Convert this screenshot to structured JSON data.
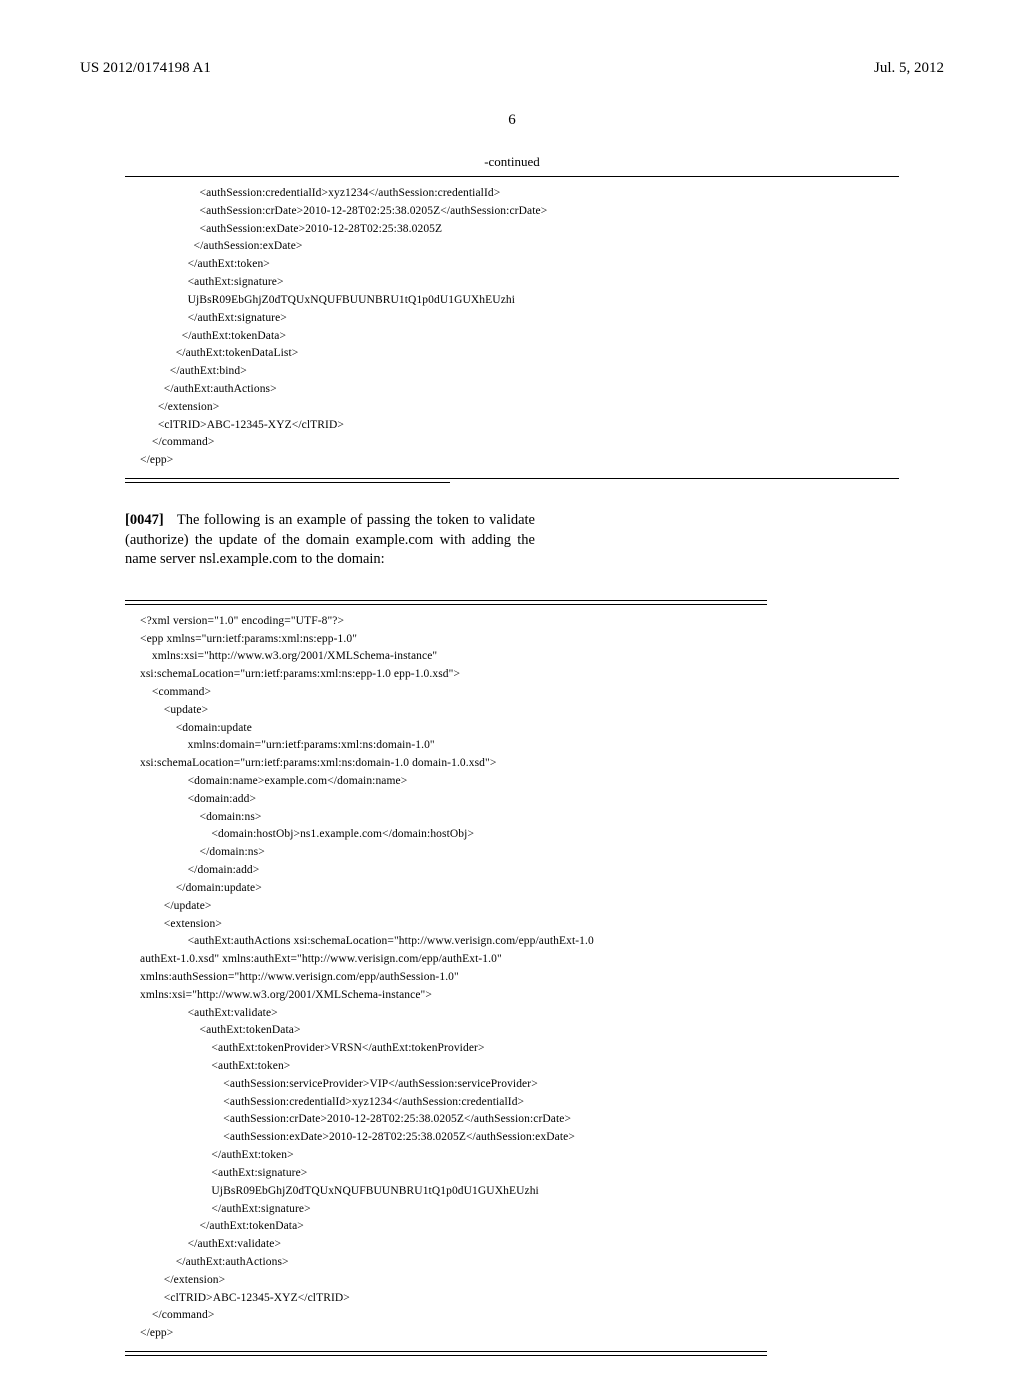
{
  "header": {
    "pub_number": "US 2012/0174198 A1",
    "date": "Jul. 5, 2012",
    "page_number": "6"
  },
  "continued_label": "-continued",
  "code_block_1": "                    <authSession:credentialId>xyz1234</authSession:credentialId>\n                    <authSession:crDate>2010-12-28T02:25:38.0205Z</authSession:crDate>\n                    <authSession:exDate>2010-12-28T02:25:38.0205Z\n                  </authSession:exDate>\n                </authExt:token>\n                <authExt:signature>\n                UjBsR09EbGhjZ0dTQUxNQUFBUUNBRU1tQ1p0dU1GUXhEUzhi\n                </authExt:signature>\n              </authExt:tokenData>\n            </authExt:tokenDataList>\n          </authExt:bind>\n        </authExt:authActions>\n      </extension>\n      <clTRID>ABC-12345-XYZ</clTRID>\n    </command>\n</epp>",
  "paragraph": {
    "num": "[0047]",
    "text": "The following is an example of passing the token to validate (authorize) the update of the domain example.com with adding the name server nsl.example.com to the domain:"
  },
  "code_block_2": "<?xml version=\"1.0\" encoding=\"UTF-8\"?>\n<epp xmlns=\"urn:ietf:params:xml:ns:epp-1.0\"\n    xmlns:xsi=\"http://www.w3.org/2001/XMLSchema-instance\"\nxsi:schemaLocation=\"urn:ietf:params:xml:ns:epp-1.0 epp-1.0.xsd\">\n    <command>\n        <update>\n            <domain:update\n                xmlns:domain=\"urn:ietf:params:xml:ns:domain-1.0\"\nxsi:schemaLocation=\"urn:ietf:params:xml:ns:domain-1.0 domain-1.0.xsd\">\n                <domain:name>example.com</domain:name>\n                <domain:add>\n                    <domain:ns>\n                        <domain:hostObj>ns1.example.com</domain:hostObj>\n                    </domain:ns>\n                </domain:add>\n            </domain:update>\n        </update>\n        <extension>\n                <authExt:authActions xsi:schemaLocation=\"http://www.verisign.com/epp/authExt-1.0\nauthExt-1.0.xsd\" xmlns:authExt=\"http://www.verisign.com/epp/authExt-1.0\"\nxmlns:authSession=\"http://www.verisign.com/epp/authSession-1.0\"\nxmlns:xsi=\"http://www.w3.org/2001/XMLSchema-instance\">\n                <authExt:validate>\n                    <authExt:tokenData>\n                        <authExt:tokenProvider>VRSN</authExt:tokenProvider>\n                        <authExt:token>\n                            <authSession:serviceProvider>VIP</authSession:serviceProvider>\n                            <authSession:credentialId>xyz1234</authSession:credentialId>\n                            <authSession:crDate>2010-12-28T02:25:38.0205Z</authSession:crDate>\n                            <authSession:exDate>2010-12-28T02:25:38.0205Z</authSession:exDate>\n                        </authExt:token>\n                        <authExt:signature>\n                        UjBsR09EbGhjZ0dTQUxNQUFBUUNBRU1tQ1p0dU1GUXhEUzhi\n                        </authExt:signature>\n                    </authExt:tokenData>\n                </authExt:validate>\n            </authExt:authActions>\n        </extension>\n        <clTRID>ABC-12345-XYZ</clTRID>\n    </command>\n</epp>"
}
